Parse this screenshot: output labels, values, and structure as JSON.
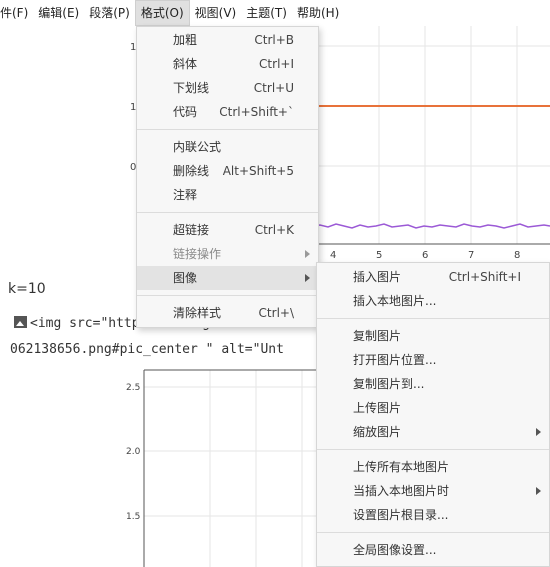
{
  "menubar": {
    "items": [
      {
        "label": "件(F)"
      },
      {
        "label": "编辑(E)"
      },
      {
        "label": "段落(P)"
      },
      {
        "label": "格式(O)"
      },
      {
        "label": "视图(V)"
      },
      {
        "label": "主题(T)"
      },
      {
        "label": "帮助(H)"
      }
    ]
  },
  "chart_top": {
    "ytick_labels": [
      "1",
      "1",
      "0"
    ],
    "xtick_labels": [
      "4",
      "5",
      "6",
      "7",
      "8"
    ],
    "colors": {
      "orange": "#e8723a",
      "purple": "#9b59d6"
    }
  },
  "editor": {
    "k_line": "k=10",
    "code_line1": "<img src=\"https://raw.githubuserco",
    "code_line2": "062138656.png#pic_center \" alt=\"Unt"
  },
  "chart_bottom": {
    "ytick_labels": [
      "2.5",
      "2.0",
      "1.5"
    ]
  },
  "format_menu": {
    "group1": [
      {
        "label": "加粗",
        "shortcut": "Ctrl+B"
      },
      {
        "label": "斜体",
        "shortcut": "Ctrl+I"
      },
      {
        "label": "下划线",
        "shortcut": "Ctrl+U"
      },
      {
        "label": "代码",
        "shortcut": "Ctrl+Shift+`"
      }
    ],
    "group2": [
      {
        "label": "内联公式",
        "shortcut": ""
      },
      {
        "label": "删除线",
        "shortcut": "Alt+Shift+5"
      },
      {
        "label": "注释",
        "shortcut": ""
      }
    ],
    "group3": [
      {
        "label": "超链接",
        "shortcut": "Ctrl+K"
      },
      {
        "label": "链接操作",
        "shortcut": ""
      },
      {
        "label": "图像",
        "shortcut": ""
      }
    ],
    "group4": [
      {
        "label": "清除样式",
        "shortcut": "Ctrl+\\"
      }
    ]
  },
  "image_menu": {
    "group1": [
      {
        "label": "插入图片",
        "shortcut": "Ctrl+Shift+I"
      },
      {
        "label": "插入本地图片...",
        "shortcut": ""
      }
    ],
    "group2": [
      {
        "label": "复制图片"
      },
      {
        "label": "打开图片位置..."
      },
      {
        "label": "复制图片到..."
      },
      {
        "label": "上传图片"
      },
      {
        "label": "缩放图片"
      }
    ],
    "group3": [
      {
        "label": "上传所有本地图片"
      },
      {
        "label": "当插入本地图片时"
      },
      {
        "label": "设置图片根目录..."
      }
    ],
    "group4": [
      {
        "label": "全局图像设置..."
      }
    ]
  }
}
